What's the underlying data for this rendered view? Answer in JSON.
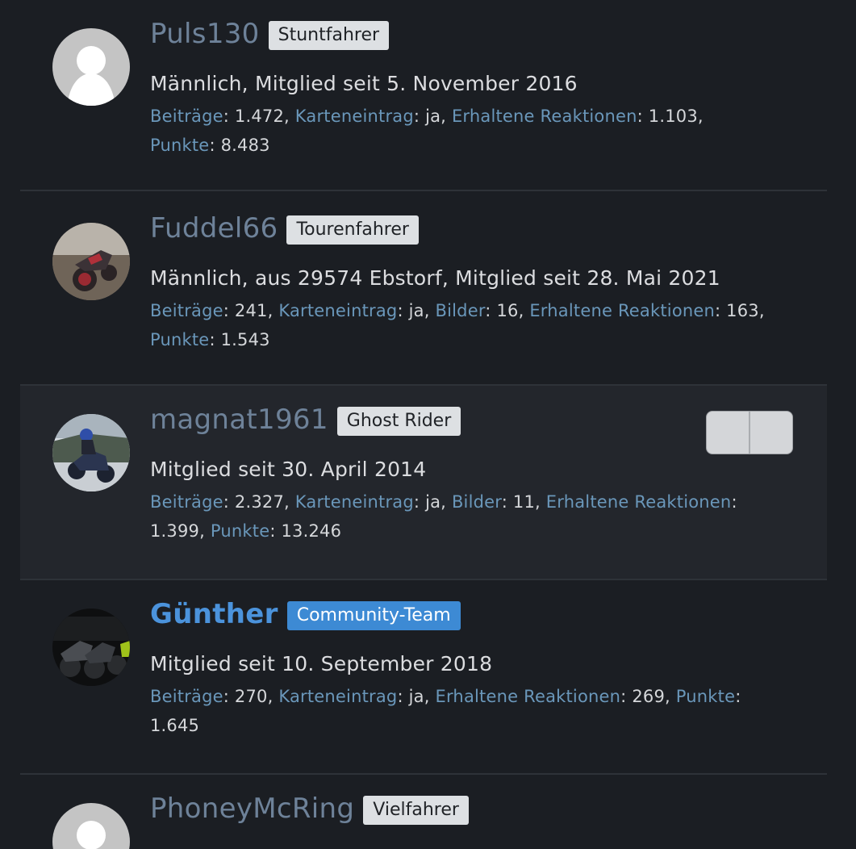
{
  "members": [
    {
      "username": "Puls130",
      "badge": "Stuntfahrer",
      "blurb": [
        "Männlich",
        "Mitglied seit 5. November 2016"
      ],
      "stats": [
        {
          "key": "Beiträge",
          "value": "1.472"
        },
        {
          "key": "Karteneintrag",
          "value": "ja"
        },
        {
          "key": "Erhaltene Reaktionen",
          "value": "1.103"
        },
        {
          "key": "Punkte",
          "value": "8.483"
        }
      ]
    },
    {
      "username": "Fuddel66",
      "badge": "Tourenfahrer",
      "blurb": [
        "Männlich",
        "aus 29574 Ebstorf",
        "Mitglied seit 28. Mai 2021"
      ],
      "stats": [
        {
          "key": "Beiträge",
          "value": "241"
        },
        {
          "key": "Karteneintrag",
          "value": "ja"
        },
        {
          "key": "Bilder",
          "value": "16"
        },
        {
          "key": "Erhaltene Reaktionen",
          "value": "163"
        },
        {
          "key": "Punkte",
          "value": "1.543"
        }
      ]
    },
    {
      "username": "magnat1961",
      "badge": "Ghost Rider",
      "blurb": [
        "Mitglied seit 30. April 2014"
      ],
      "stats": [
        {
          "key": "Beiträge",
          "value": "2.327"
        },
        {
          "key": "Karteneintrag",
          "value": "ja"
        },
        {
          "key": "Bilder",
          "value": "11"
        },
        {
          "key": "Erhaltene Reaktionen",
          "value": "1.399"
        },
        {
          "key": "Punkte",
          "value": "13.246"
        }
      ]
    },
    {
      "username": "Günther",
      "badge": "Community-Team",
      "blurb": [
        "Mitglied seit 10. September 2018"
      ],
      "stats": [
        {
          "key": "Beiträge",
          "value": "270"
        },
        {
          "key": "Karteneintrag",
          "value": "ja"
        },
        {
          "key": "Erhaltene Reaktionen",
          "value": "269"
        },
        {
          "key": "Punkte",
          "value": "1.645"
        }
      ]
    },
    {
      "username": "PhoneyMcRing",
      "badge": "Vielfahrer"
    }
  ],
  "colors": {
    "background": "#1b1e23",
    "username": "#6e8299",
    "team_accent": "#4b93dc",
    "stat_key": "#6a97ba",
    "badge_bg": "#dde0e3"
  }
}
